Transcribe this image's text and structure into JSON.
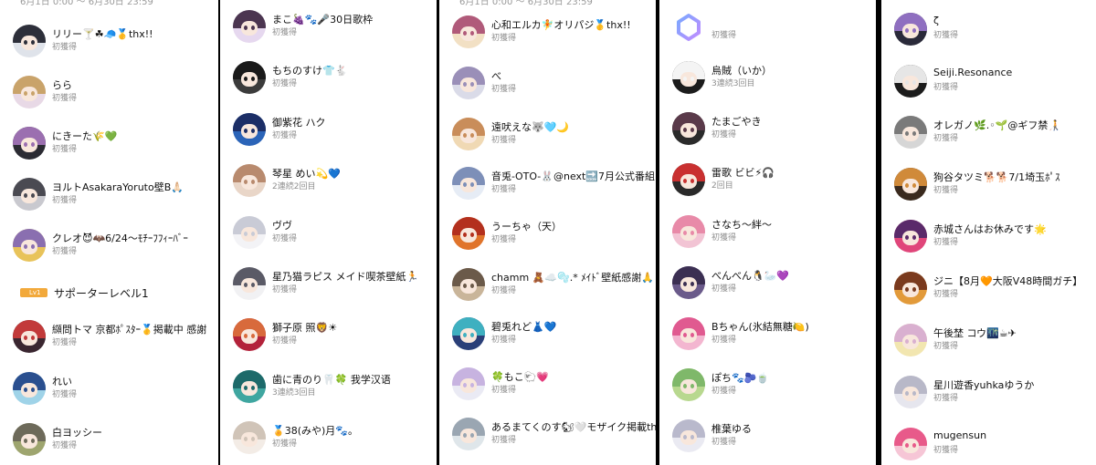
{
  "panels": [
    {
      "header": "6月1日 0:00 〜 6月30日 23:59",
      "level_section": {
        "badge": "Lv1",
        "title": "サポーターレベル1"
      },
      "rows": [
        {
          "name": "リリー🍸☘🧢🥇thx!!",
          "status": "初獲得",
          "colors": [
            "#dfe3ea",
            "#2d2f3a"
          ]
        },
        {
          "name": "らら",
          "status": "初獲得",
          "colors": [
            "#e8d9e6",
            "#c9a36a"
          ]
        },
        {
          "name": "にきーた🌾💚",
          "status": "初獲得",
          "colors": [
            "#2b2b33",
            "#9b6fb0"
          ]
        },
        {
          "name": "ヨルトAsakaraYoruto壁B🙏🏻",
          "status": "初獲得",
          "colors": [
            "#c9c9cf",
            "#4a4a52"
          ]
        },
        {
          "name": "クレオ😈🦇6/24〜ﾓﾁｰﾌﾌｨｰﾊﾞｰ",
          "status": "初獲得",
          "colors": [
            "#e8c35a",
            "#8a6fb0"
          ]
        },
        {
          "name": "纐問トマ 京都ﾎﾟｽﾀｰ🥇掲載中 感謝",
          "status": "初獲得",
          "colors": [
            "#3a2630",
            "#c23a3a"
          ]
        },
        {
          "name": "れい",
          "status": "初獲得",
          "colors": [
            "#9fd3e8",
            "#2a4f8f"
          ]
        },
        {
          "name": "白ヨッシー",
          "status": "初獲得",
          "colors": [
            "#9ea56f",
            "#6d6a5a"
          ]
        }
      ]
    },
    {
      "header": "",
      "rows": [
        {
          "name": "まこ🍇🐾🎤30日歌枠",
          "status": "初獲得",
          "colors": [
            "#e6d8ef",
            "#4b3550"
          ]
        },
        {
          "name": "もちのすけ👕🐇",
          "status": "初獲得",
          "colors": [
            "#3b3b3b",
            "#1a1a1a"
          ]
        },
        {
          "name": "御紫花 ハク",
          "status": "初獲得",
          "colors": [
            "#2b64b8",
            "#1c2e66"
          ]
        },
        {
          "name": "琴星 めい💫💙",
          "status": "2連続2回目",
          "colors": [
            "#e9d6c8",
            "#b88a6e"
          ]
        },
        {
          "name": "ヴヴ",
          "status": "初獲得",
          "colors": [
            "#f3f3f6",
            "#c9cbd6"
          ]
        },
        {
          "name": "星乃猫ラピス メイド喫茶壁紙🏃",
          "status": "初獲得",
          "colors": [
            "#f1f1f3",
            "#5a5a66"
          ]
        },
        {
          "name": "獅子原 照🦁☀",
          "status": "初獲得",
          "colors": [
            "#b3223a",
            "#d86a3c"
          ]
        },
        {
          "name": "歯に青のり🦷🍀 我学汉语",
          "status": "3連続3回目",
          "colors": [
            "#3fa6a0",
            "#1d6a6a"
          ]
        },
        {
          "name": "🏅38(みや)月🐾。",
          "status": "初獲得",
          "colors": [
            "#f3ece6",
            "#d0c4b8"
          ]
        }
      ]
    },
    {
      "header": "6月1日 0:00 〜 6月30日 23:59",
      "rows": [
        {
          "name": "心和エルカ🧚オリパジ🥇thx!!",
          "status": "初獲得",
          "colors": [
            "#f2e0c4",
            "#b05a7a"
          ]
        },
        {
          "name": "べ",
          "status": "初獲得",
          "colors": [
            "#dadbe8",
            "#9a8fb8"
          ]
        },
        {
          "name": "遠吠えな🐺🩵🌙",
          "status": "初獲得",
          "colors": [
            "#f0d9b4",
            "#c98d5a"
          ]
        },
        {
          "name": "音兎-OTO-🐰@next🔜7月公式番組",
          "status": "初獲得",
          "colors": [
            "#e6ecf5",
            "#7d8fb8"
          ]
        },
        {
          "name": "うーちゃ（天）",
          "status": "初獲得",
          "colors": [
            "#e0742b",
            "#b3301e"
          ]
        },
        {
          "name": "chamm 🧸☁️🫧.* ﾒｲﾄﾞ壁紙感謝🙏",
          "status": "初獲得",
          "colors": [
            "#c9b59a",
            "#6b5a4a"
          ]
        },
        {
          "name": "碧兎れど👗💙",
          "status": "初獲得",
          "colors": [
            "#2a3f78",
            "#3fb0c0"
          ]
        },
        {
          "name": "🍀もこ🐑💗",
          "status": "初獲得",
          "colors": [
            "#eaeaf4",
            "#c7b3e0"
          ]
        },
        {
          "name": "あるまてくのす🐿🤍モザイク掲載thx",
          "status": "初獲得",
          "colors": [
            "#dfe6ea",
            "#9aa6b2"
          ]
        }
      ]
    },
    {
      "header": "",
      "rows": [
        {
          "name": "",
          "status": "初獲得",
          "colors": [
            "#8ab0ff",
            "#b38cff"
          ]
        },
        {
          "name": "烏賊（いか）",
          "status": "3連続3回目",
          "colors": [
            "#1c1c1c",
            "#f4f4f4"
          ]
        },
        {
          "name": "たまごやき",
          "status": "初獲得",
          "colors": [
            "#2b2b2b",
            "#5a3a4a"
          ]
        },
        {
          "name": "雷歌 ビビ⚡🎧",
          "status": "2回目",
          "colors": [
            "#2a2a2a",
            "#c93030"
          ]
        },
        {
          "name": "さなち〜絆〜",
          "status": "初獲得",
          "colors": [
            "#f2c4d4",
            "#e88aa8"
          ]
        },
        {
          "name": "べんべん🐧🦢💜",
          "status": "初獲得",
          "colors": [
            "#6a5a8a",
            "#3b2f52"
          ]
        },
        {
          "name": "Bちゃん(氷結無糖🍋)",
          "status": "初獲得",
          "colors": [
            "#f3b6d0",
            "#e05a90"
          ]
        },
        {
          "name": "ぽち🐾🫐🍵",
          "status": "初獲得",
          "colors": [
            "#b8d88f",
            "#7fb86a"
          ]
        },
        {
          "name": "椎葉ゆる",
          "status": "初獲得",
          "colors": [
            "#eaeaf2",
            "#b9b9cc"
          ]
        }
      ]
    },
    {
      "header": "",
      "rows": [
        {
          "name": "ζ",
          "status": "初獲得",
          "colors": [
            "#2a2a3a",
            "#8f6fc0"
          ]
        },
        {
          "name": "Seiji.Resonance",
          "status": "初獲得",
          "colors": [
            "#1c1c1c",
            "#e6e6e6"
          ]
        },
        {
          "name": "オレガノ🌿.◦🌱@ギフ禁🧑‍🦯",
          "status": "初獲得",
          "colors": [
            "#d6d6d6",
            "#7a7a7a"
          ]
        },
        {
          "name": "狗谷タツミ🐕🐕7/1埼玉ﾎﾟｽ",
          "status": "初獲得",
          "colors": [
            "#3a2a1e",
            "#d08a3a"
          ]
        },
        {
          "name": "赤城さんはお休みです🌟",
          "status": "初獲得",
          "colors": [
            "#e0467a",
            "#5a2a6a"
          ]
        },
        {
          "name": "ジニ【8月🧡大阪V48時間ガチ】",
          "status": "初獲得",
          "colors": [
            "#e29a3a",
            "#7a3a1e"
          ]
        },
        {
          "name": "午後埜 コウ🌃☕✈",
          "status": "初獲得",
          "colors": [
            "#f2e6b0",
            "#d9b0d0"
          ]
        },
        {
          "name": "星川遊香yuhkaゆうか",
          "status": "初獲得",
          "colors": [
            "#e6e6ee",
            "#b8b8c8"
          ]
        },
        {
          "name": "mugensun",
          "status": "初獲得",
          "colors": [
            "#f6c6d6",
            "#e85a8a"
          ]
        }
      ]
    }
  ]
}
